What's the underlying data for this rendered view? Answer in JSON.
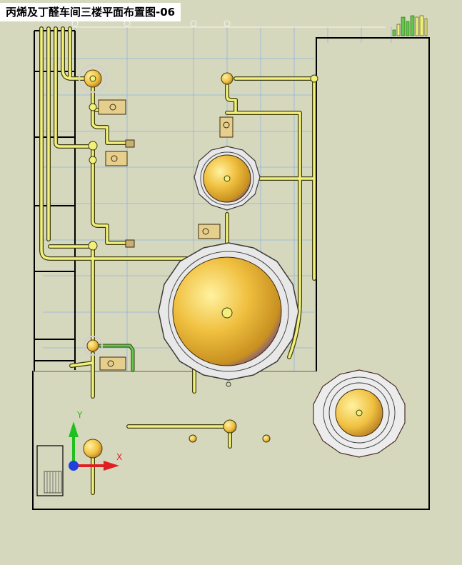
{
  "title": "丙烯及丁醛车间三楼平面布置图-06",
  "ucs": {
    "x_label": "X",
    "y_label": "Y"
  },
  "colors": {
    "background": "#d6d8bd",
    "pipe_yellow": "#f2f07a",
    "pipe_green": "#5ec94a",
    "vessel_gold": "#f0c040",
    "grid_blue": "#8fb3e0",
    "axis_red": "#e02020",
    "axis_green": "#20c020",
    "axis_blue": "#2040e0"
  }
}
